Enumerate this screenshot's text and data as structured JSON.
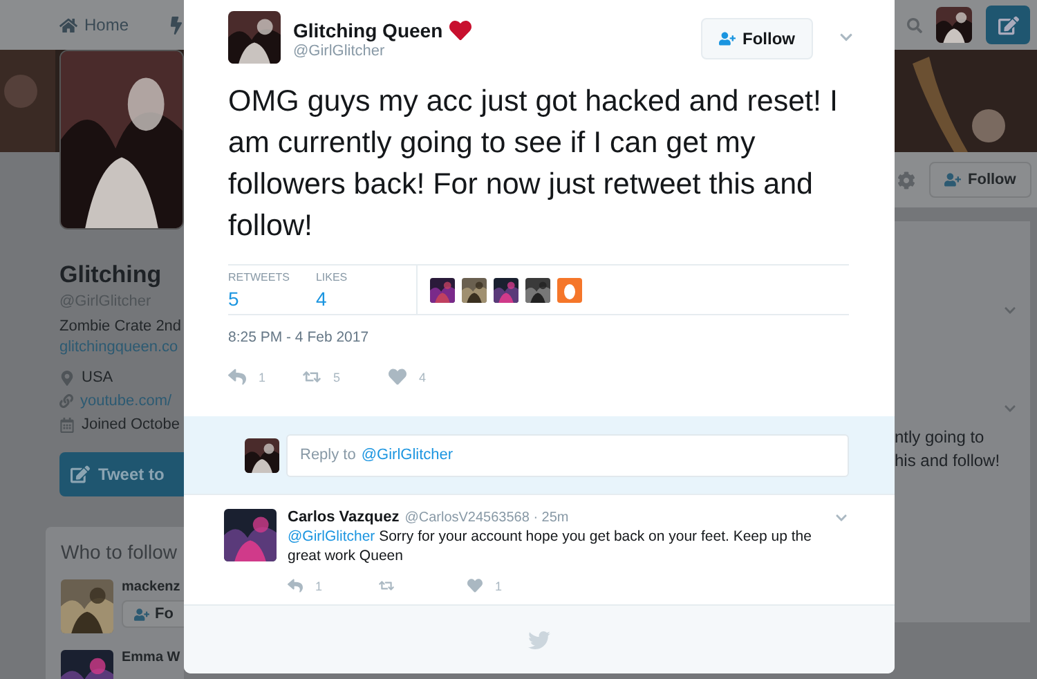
{
  "nav": {
    "home": "Home"
  },
  "profile": {
    "name": "Glitching",
    "handle": "@GirlGlitcher",
    "bio": "Zombie Crate 2nd",
    "website": "glitchingqueen.co",
    "location": "USA",
    "link": "youtube.com/",
    "joined": "Joined Octobe",
    "tweet_button": "Tweet to"
  },
  "who_to_follow": {
    "title": "Who to follow",
    "accounts": [
      {
        "name": "mackenz",
        "follow": "Fo"
      },
      {
        "name": "Emma W"
      }
    ]
  },
  "profile_nav": {
    "follow": "Follow"
  },
  "timeline_text": [
    "ntly going to",
    "his and follow!"
  ],
  "tweet": {
    "author": {
      "name": "Glitching Queen",
      "handle": "@GirlGlitcher"
    },
    "follow_button": "Follow",
    "text": "OMG guys my acc just got hacked and reset! I am currently going to see if I can get my followers back! For now just retweet this and follow!",
    "stats": [
      {
        "label": "RETWEETS",
        "value": "5"
      },
      {
        "label": "LIKES",
        "value": "4"
      }
    ],
    "likers": [
      {
        "kind": "picture"
      },
      {
        "kind": "picture"
      },
      {
        "kind": "picture"
      },
      {
        "kind": "picture"
      },
      {
        "kind": "egg"
      }
    ],
    "timestamp": "8:25 PM - 4 Feb 2017",
    "actions": [
      {
        "kind": "reply",
        "count": "1"
      },
      {
        "kind": "retweet",
        "count": "5"
      },
      {
        "kind": "like",
        "count": "4"
      }
    ]
  },
  "reply_box": {
    "placeholder": "Reply to",
    "mention": "@GirlGlitcher"
  },
  "replies": [
    {
      "name": "Carlos Vazquez",
      "meta": "@CarlosV24563568 · 25m",
      "mention": "@GirlGlitcher",
      "text": "Sorry for your account hope you get back on your feet. Keep up the great work Queen",
      "actions": [
        {
          "kind": "reply",
          "count": "1"
        },
        {
          "kind": "retweet"
        },
        {
          "kind": "like",
          "count": "1"
        }
      ]
    }
  ]
}
